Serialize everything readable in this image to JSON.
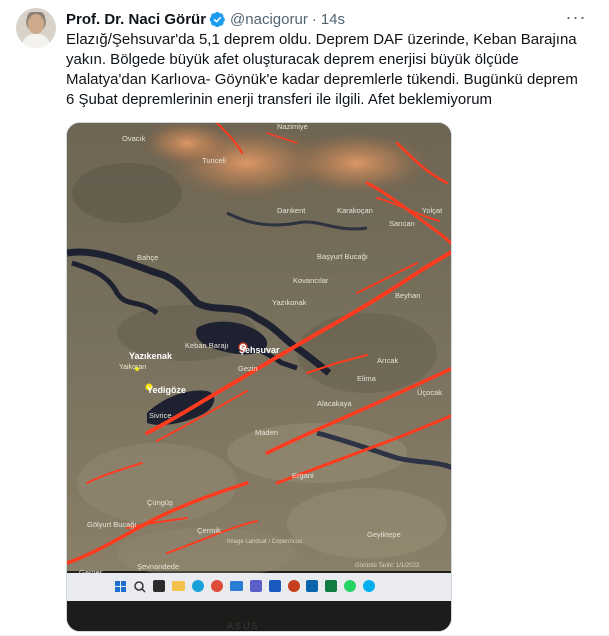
{
  "tweet": {
    "author_name": "Prof. Dr. Naci Görür",
    "handle": "@nacigorur",
    "separator": "·",
    "time": "14s",
    "more_glyph": "···",
    "text": "Elazığ/Şehsuvar'da 5,1 deprem oldu. Deprem DAF üzerinde, Keban Barajına yakın. Bölgede büyük afet oluşturacak deprem enerjisi büyük ölçüde Malatya'dan Karlıova- Göynük'e kadar depremlerle tükendi. Bugünkü deprem 6 Şubat depremlerinin enerji transferi ile ilgili. Afet beklemiyorum"
  },
  "map": {
    "places": {
      "nazimiye": "Nazimiye",
      "tunceli": "Tunceli",
      "ovacik": "Ovacık",
      "darikent": "Darıkent",
      "karakocan": "Karakoçan",
      "yolcat": "Yolçat",
      "saricam": "Sarıcan",
      "basyurt": "Başyurt Bucağı",
      "bahce": "Bahçe",
      "beyhan": "Beyhan",
      "kovancilar": "Kovancılar",
      "yazikonak_map": "Yazıkonak",
      "keban_baraji": "Keban Barajı",
      "sehsuvar": "Şehsuvar",
      "yazikenak": "Yazıkenak",
      "yaikoran": "Yaikoran",
      "yedigoze": "Yedigöze",
      "gezin": "Gezin",
      "aricak": "Arıcak",
      "elima": "Elima",
      "ucocak": "Üçocak",
      "alacakaya": "Alacakaya",
      "sivrice": "Sivrice",
      "maden": "Maden",
      "ergani": "Ergani",
      "cungus": "Çüngüş",
      "cermik": "Çermik",
      "golyurt": "Gölyurt Bucağı",
      "geyiktepe": "Geyiktepe",
      "sevnandede": "Şevnandede",
      "gerger": "Gerger",
      "attribution": "Image Landsat / Copernicus",
      "imagery_date": "Görüntü Tarihi: 1/1/2023"
    },
    "accent": "#ff3b1f"
  },
  "taskbar": {
    "icons": [
      "windows-icon",
      "search-icon",
      "file-explorer-icon",
      "folder-icon",
      "edge-icon",
      "chrome-icon",
      "mail-icon",
      "teams-icon",
      "word-icon",
      "powerpoint-icon",
      "outlook-icon",
      "excel-icon",
      "whatsapp-icon",
      "skype-icon"
    ],
    "laptop_brand": "ASUS"
  },
  "colors": {
    "verified_blue": "#1d9bf0",
    "text": "#0f1419",
    "secondary": "#536471"
  }
}
